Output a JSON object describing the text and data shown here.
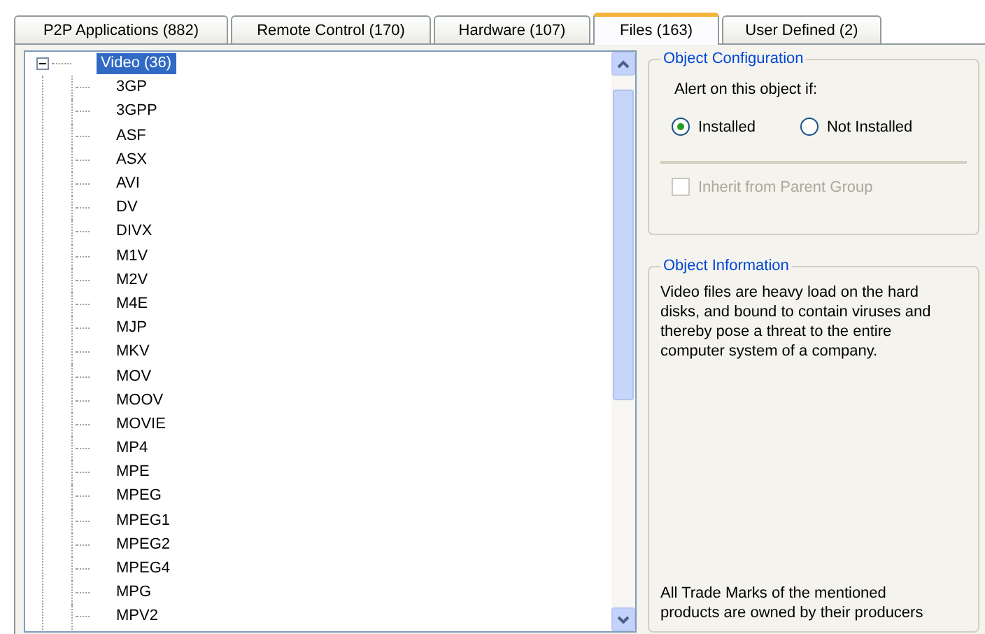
{
  "tabs": [
    {
      "label": "P2P Applications (882)",
      "selected": false
    },
    {
      "label": "Remote Control (170)",
      "selected": false
    },
    {
      "label": "Hardware (107)",
      "selected": false
    },
    {
      "label": "Files (163)",
      "selected": true
    },
    {
      "label": "User Defined (2)",
      "selected": false
    }
  ],
  "tree": {
    "label": "Video (36)",
    "expanded": true,
    "selected": true,
    "children": [
      {
        "label": "3GP"
      },
      {
        "label": "3GPP"
      },
      {
        "label": "ASF"
      },
      {
        "label": "ASX"
      },
      {
        "label": "AVI"
      },
      {
        "label": "DV"
      },
      {
        "label": "DIVX"
      },
      {
        "label": "M1V"
      },
      {
        "label": "M2V"
      },
      {
        "label": "M4E"
      },
      {
        "label": "MJP"
      },
      {
        "label": "MKV"
      },
      {
        "label": "MOV"
      },
      {
        "label": "MOOV"
      },
      {
        "label": "MOVIE"
      },
      {
        "label": "MP4"
      },
      {
        "label": "MPE"
      },
      {
        "label": "MPEG"
      },
      {
        "label": "MPEG1"
      },
      {
        "label": "MPEG2"
      },
      {
        "label": "MPEG4"
      },
      {
        "label": "MPG"
      },
      {
        "label": "MPV2"
      }
    ]
  },
  "object_configuration": {
    "title": "Object Configuration",
    "prompt": "Alert on this object if:",
    "options": [
      {
        "label": "Installed",
        "selected": true
      },
      {
        "label": "Not Installed",
        "selected": false
      }
    ],
    "inherit": {
      "label": "Inherit from Parent Group",
      "checked": false,
      "disabled": true
    }
  },
  "object_information": {
    "title": "Object Information",
    "text": "Video files are heavy load on the hard disks, and bound to contain viruses and thereby pose a threat to the entire computer system of a company.",
    "footer": "All Trade Marks of the mentioned products are owned by their producers"
  }
}
